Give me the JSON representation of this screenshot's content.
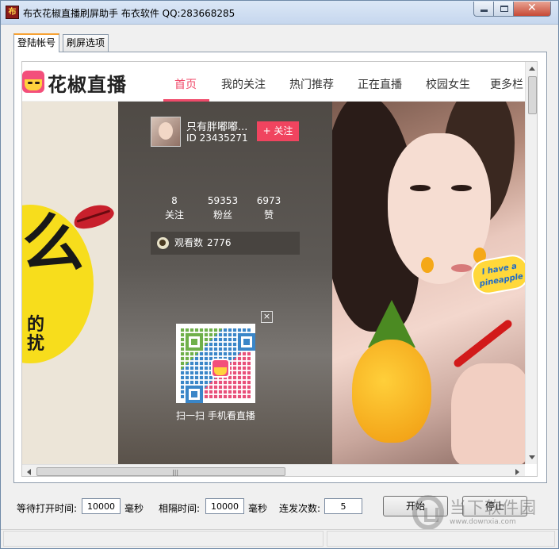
{
  "window": {
    "title": "布衣花椒直播刷屏助手   布衣软件 QQ:283668285",
    "icon_label": "布"
  },
  "tabs": [
    {
      "label": "登陆帐号",
      "active": true
    },
    {
      "label": "刷屏选项",
      "active": false
    }
  ],
  "site": {
    "logo_text": "花椒直播",
    "nav": [
      "首页",
      "我的关注",
      "热门推荐",
      "正在直播",
      "校园女生",
      "更多栏目"
    ],
    "active_nav": "首页"
  },
  "anchor": {
    "name": "只有胖嘟嘟...",
    "id_text": "ID 23435271",
    "follow_label": "+ 关注",
    "stats": [
      {
        "value": "8",
        "label": "关注"
      },
      {
        "value": "59353",
        "label": "粉丝"
      },
      {
        "value": "6973",
        "label": "赞"
      }
    ],
    "viewers_label": "观看数",
    "viewers_count": "2776",
    "qr_caption": "扫一扫 手机看直播",
    "qr_close": "×"
  },
  "stream": {
    "left_big_text": "么",
    "left_small_text": "的\n扰",
    "sticker_text": "I have a pineapple"
  },
  "controls": {
    "wait_open_label": "等待打开时间:",
    "wait_open_value": "10000",
    "wait_open_unit": "毫秒",
    "interval_label": "相隔时间:",
    "interval_value": "10000",
    "interval_unit": "毫秒",
    "repeat_label": "连发次数:",
    "repeat_value": "5",
    "start_label": "开始",
    "stop_label": "停止"
  },
  "watermark": {
    "name": "当下软件园",
    "url": "www.downxia.com"
  },
  "colors": {
    "accent_pink": "#f04a6a",
    "tab_highlight": "#f7a233"
  }
}
